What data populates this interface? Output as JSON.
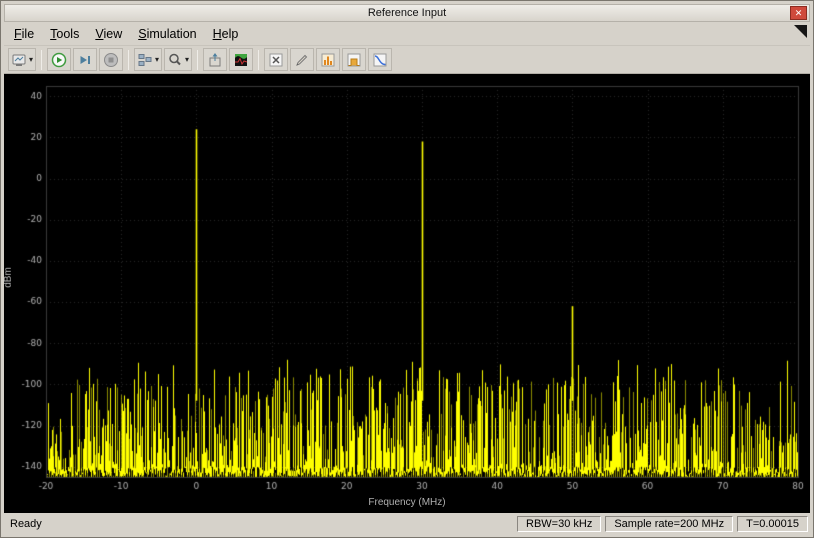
{
  "window": {
    "title": "Reference Input",
    "close_glyph": "✕"
  },
  "menu": {
    "items": [
      {
        "label": "File",
        "mnemonic": "F"
      },
      {
        "label": "Tools",
        "mnemonic": "T"
      },
      {
        "label": "View",
        "mnemonic": "V"
      },
      {
        "label": "Simulation",
        "mnemonic": "S"
      },
      {
        "label": "Help",
        "mnemonic": "H"
      }
    ]
  },
  "toolbar": {
    "dropdown_glyph": "▾",
    "buttons": [
      {
        "name": "scope-settings",
        "icon": "scope-settings-icon",
        "dropdown": true
      },
      {
        "name": "run",
        "icon": "play-icon"
      },
      {
        "name": "step-forward",
        "icon": "step-forward-icon"
      },
      {
        "name": "stop",
        "icon": "stop-icon"
      },
      {
        "name": "simulink-step-options",
        "icon": "blocks-icon",
        "dropdown": true
      },
      {
        "name": "zoom",
        "icon": "magnifier-icon",
        "dropdown": true
      },
      {
        "name": "scale-axes",
        "icon": "scale-axes-icon"
      },
      {
        "name": "spectrogram",
        "icon": "spectrogram-icon"
      },
      {
        "name": "cursor-measurements",
        "icon": "cursor-x-icon"
      },
      {
        "name": "peak-finder",
        "icon": "pencil-icon"
      },
      {
        "name": "distortion-measurements",
        "icon": "distortion-bars-icon"
      },
      {
        "name": "channel-measurements",
        "icon": "channel-power-icon"
      },
      {
        "name": "ccdf-measurements",
        "icon": "ccdf-curve-icon"
      }
    ]
  },
  "status_bar": {
    "left": "Ready",
    "segments": [
      "RBW=30 kHz",
      "Sample rate=200 MHz",
      "T=0.00015"
    ]
  },
  "chart_data": {
    "type": "line",
    "title": "",
    "xlabel": "Frequency (MHz)",
    "ylabel": "dBm",
    "xlim": [
      -20,
      80
    ],
    "ylim": [
      -145,
      45
    ],
    "xticks": [
      -20,
      -10,
      0,
      10,
      20,
      30,
      40,
      50,
      60,
      70,
      80
    ],
    "yticks": [
      40,
      20,
      0,
      -20,
      -40,
      -60,
      -80,
      -100,
      -120,
      -140
    ],
    "grid": true,
    "legend": false,
    "background": "#000000",
    "grid_color": "#282828",
    "axis_text_color": "#b0b0b0",
    "trace_color": "#ffff00",
    "peaks": [
      {
        "freq_mhz": 0,
        "level_dbm": 24
      },
      {
        "freq_mhz": 30,
        "level_dbm": 18
      },
      {
        "freq_mhz": 50,
        "level_dbm": -62
      }
    ],
    "noise": {
      "seed": 1337,
      "floor_dbm": -145,
      "spike_max_dbm": -88,
      "shape": 2.2
    }
  }
}
